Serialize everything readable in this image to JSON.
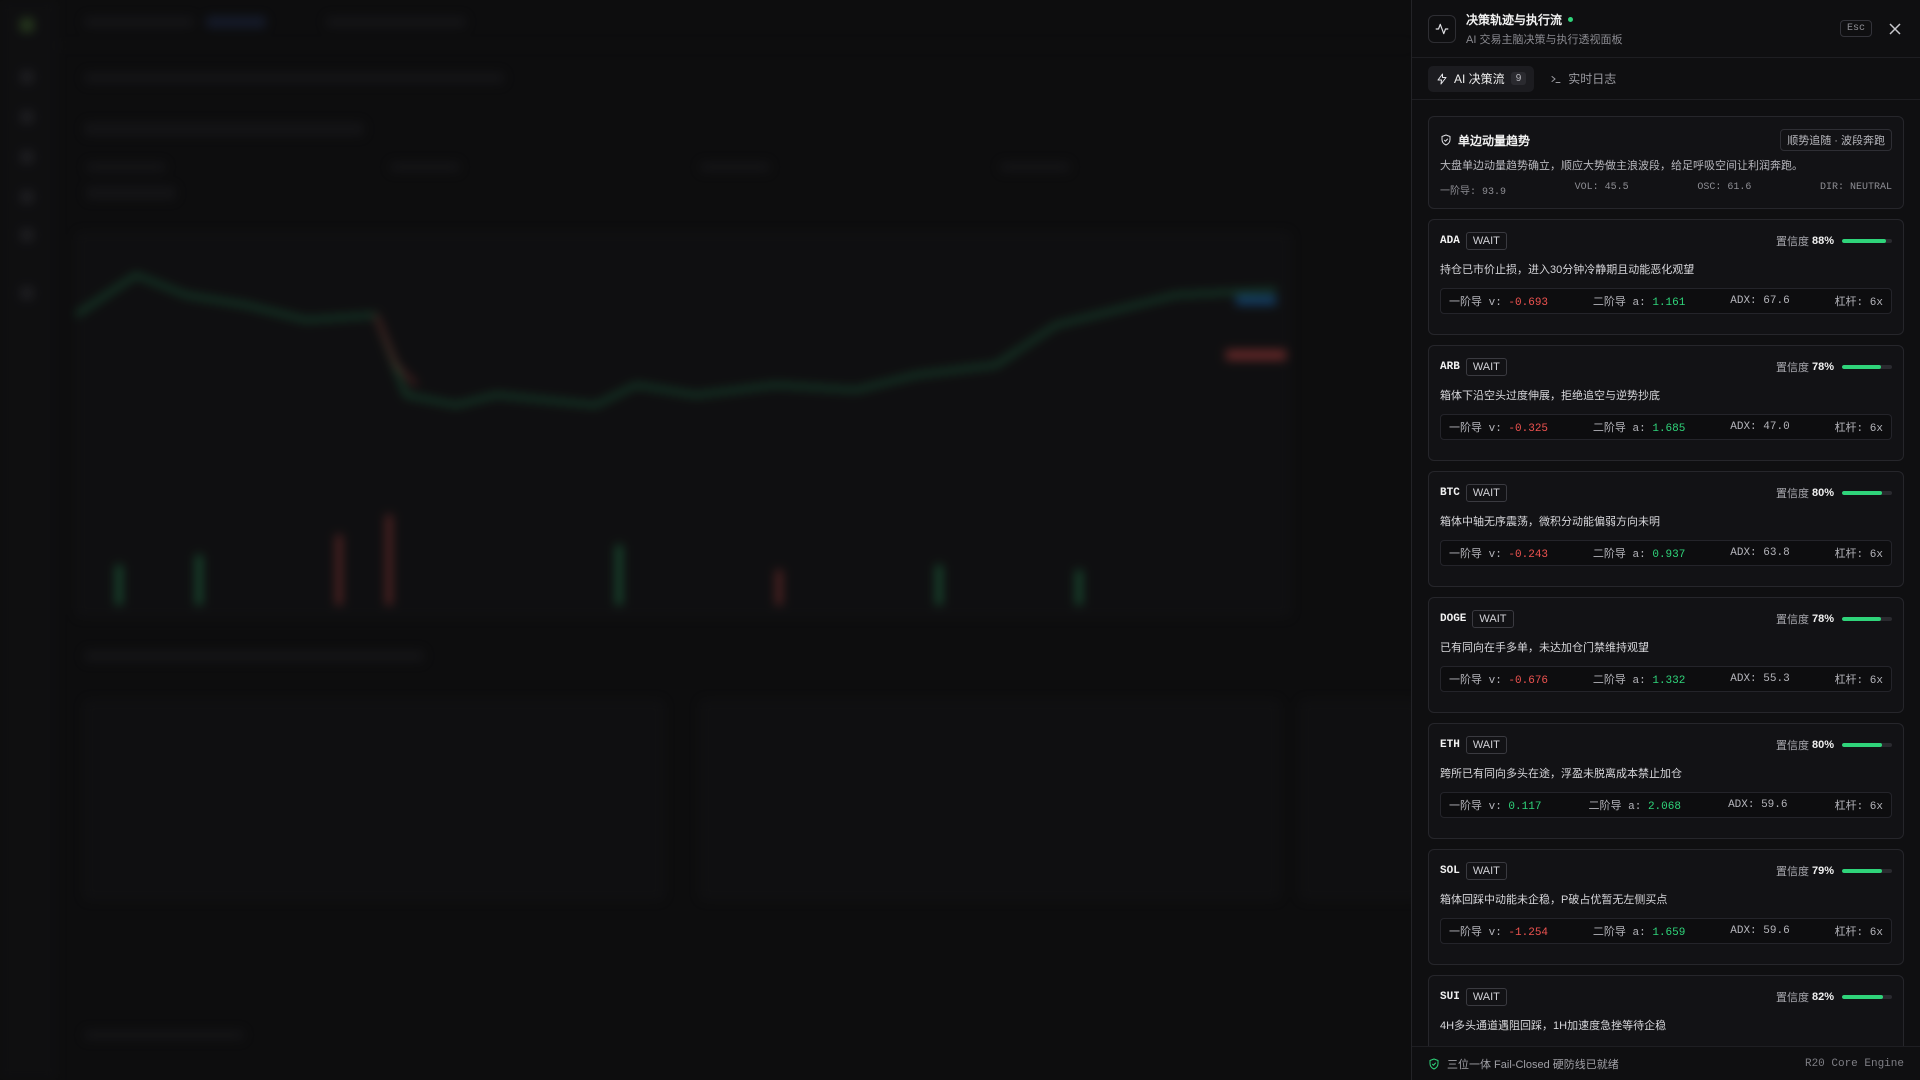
{
  "drawer": {
    "title": "决策轨迹与执行流",
    "subtitle": "AI 交易主脑决策与执行透视面板",
    "esc_label": "Esc",
    "tabs": [
      {
        "label": "AI 决策流",
        "count": "9"
      },
      {
        "label": "实时日志"
      }
    ],
    "regime": {
      "title": "单边动量趋势",
      "tag": "顺势追随 · 波段奔跑",
      "description": "大盘单边动量趋势确立，顺应大势做主浪波段，给足呼吸空间让利润奔跑。",
      "stats": [
        "一阶导: 93.9",
        "VOL: 45.5",
        "OSC: 61.6",
        "DIR: NEUTRAL"
      ]
    },
    "confidence_label": "置信度",
    "metric_labels": {
      "v": "一阶导 v:",
      "a": "二阶导 a:",
      "adx": "ADX:",
      "lev": "杠杆:"
    },
    "decisions": [
      {
        "symbol": "ADA",
        "action": "WAIT",
        "confidence": "88%",
        "confidence_value": 0.88,
        "reason": "持仓已市价止损，进入30分钟冷静期且动能恶化观望",
        "v": "-0.693",
        "a": "1.161",
        "adx": "67.6",
        "leverage": "6x"
      },
      {
        "symbol": "ARB",
        "action": "WAIT",
        "confidence": "78%",
        "confidence_value": 0.78,
        "reason": "箱体下沿空头过度伸展，拒绝追空与逆势抄底",
        "v": "-0.325",
        "a": "1.685",
        "adx": "47.0",
        "leverage": "6x"
      },
      {
        "symbol": "BTC",
        "action": "WAIT",
        "confidence": "80%",
        "confidence_value": 0.8,
        "reason": "箱体中轴无序震荡，微积分动能偏弱方向未明",
        "v": "-0.243",
        "a": "0.937",
        "adx": "63.8",
        "leverage": "6x"
      },
      {
        "symbol": "DOGE",
        "action": "WAIT",
        "confidence": "78%",
        "confidence_value": 0.78,
        "reason": "已有同向在手多单，未达加仓门禁维持观望",
        "v": "-0.676",
        "a": "1.332",
        "adx": "55.3",
        "leverage": "6x"
      },
      {
        "symbol": "ETH",
        "action": "WAIT",
        "confidence": "80%",
        "confidence_value": 0.8,
        "reason": "跨所已有同向多头在途，浮盈未脱离成本禁止加仓",
        "v": "0.117",
        "a": "2.068",
        "adx": "59.6",
        "leverage": "6x"
      },
      {
        "symbol": "SOL",
        "action": "WAIT",
        "confidence": "79%",
        "confidence_value": 0.79,
        "reason": "箱体回踩中动能未企稳，P破占优暂无左侧买点",
        "v": "-1.254",
        "a": "1.659",
        "adx": "59.6",
        "leverage": "6x"
      },
      {
        "symbol": "SUI",
        "action": "WAIT",
        "confidence": "82%",
        "confidence_value": 0.82,
        "reason": "4H多头通道遇阻回踩，1H加速度急挫等待企稳",
        "v": "",
        "a": "",
        "adx": "",
        "leverage": ""
      }
    ],
    "footer": {
      "status": "三位一体 Fail-Closed 硬防线已就绪",
      "engine": "R20 Core Engine"
    }
  },
  "colors": {
    "accent": "#2fd47a",
    "negative": "#ef5350",
    "background": "#0f0f11"
  }
}
